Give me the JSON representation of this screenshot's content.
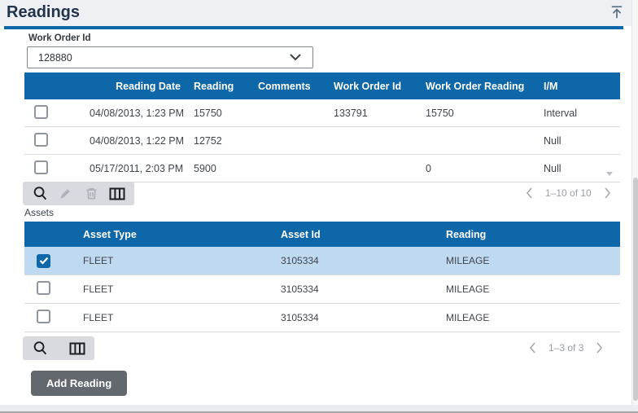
{
  "colors": {
    "header-blue": "#0e67a8",
    "title-navy": "#21334d",
    "titlebar-bg": "#eef0f4",
    "selected-row": "#bed9f0",
    "toolbar-bg": "#d9dadf",
    "button-gray": "#63686e",
    "row-border": "#d8d9db",
    "text-dark": "#40454c",
    "muted": "#9b9ea4",
    "disabled-icon": "#aeb1b7",
    "icon-dark": "#1c1e21"
  },
  "panel": {
    "title": "Readings"
  },
  "filter": {
    "label": "Work Order Id",
    "value": "128880"
  },
  "readings_table": {
    "columns": [
      "Reading Date",
      "Reading",
      "Comments",
      "Work Order Id",
      "Work Order Reading",
      "I/M"
    ],
    "rows": [
      {
        "checked": false,
        "reading_date": "04/08/2013, 1:23 PM",
        "reading": "15750",
        "comments": "",
        "work_order_id": "133791",
        "work_order_reading": "15750",
        "im": "Interval"
      },
      {
        "checked": false,
        "reading_date": "04/08/2013, 1:22 PM",
        "reading": "12752",
        "comments": "",
        "work_order_id": "",
        "work_order_reading": "",
        "im": "Null"
      },
      {
        "checked": false,
        "reading_date": "05/17/2011, 2:03 PM",
        "reading": "5900",
        "comments": "",
        "work_order_id": "",
        "work_order_reading": "0",
        "im": "Null"
      }
    ],
    "pagination": "1–10 of 10"
  },
  "assets": {
    "label": "Assets",
    "columns": [
      "Asset Type",
      "Asset Id",
      "Reading"
    ],
    "rows": [
      {
        "checked": true,
        "asset_type": "FLEET",
        "asset_id": "3105334",
        "reading": "MILEAGE"
      },
      {
        "checked": false,
        "asset_type": "FLEET",
        "asset_id": "3105334",
        "reading": "MILEAGE"
      },
      {
        "checked": false,
        "asset_type": "FLEET",
        "asset_id": "3105334",
        "reading": "MILEAGE"
      }
    ],
    "pagination": "1–3 of 3"
  },
  "actions": {
    "add_reading": "Add Reading"
  }
}
